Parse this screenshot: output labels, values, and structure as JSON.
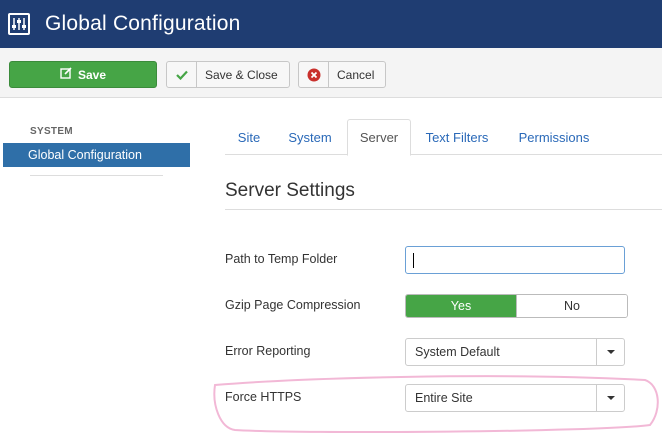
{
  "header": {
    "title": "Global Configuration",
    "icon": "sliders-icon"
  },
  "toolbar": {
    "save_label": "Save",
    "save_close_label": "Save & Close",
    "cancel_label": "Cancel"
  },
  "sidebar": {
    "heading": "SYSTEM",
    "items": [
      {
        "label": "Global Configuration",
        "active": true
      }
    ]
  },
  "tabs": [
    {
      "label": "Site",
      "active": false
    },
    {
      "label": "System",
      "active": false
    },
    {
      "label": "Server",
      "active": true
    },
    {
      "label": "Text Filters",
      "active": false
    },
    {
      "label": "Permissions",
      "active": false
    }
  ],
  "section": {
    "title": "Server Settings",
    "fields": {
      "temp_path": {
        "label": "Path to Temp Folder",
        "value": ""
      },
      "gzip": {
        "label": "Gzip Page Compression",
        "on_label": "Yes",
        "off_label": "No",
        "selected": "Yes"
      },
      "error_reporting": {
        "label": "Error Reporting",
        "value": "System Default"
      },
      "force_https": {
        "label": "Force HTTPS",
        "value": "Entire Site"
      }
    }
  },
  "colors": {
    "header_bg": "#1f3d72",
    "save_green": "#46a546",
    "active_blue": "#2f6fa8",
    "highlight_pink": "#f2b8d6"
  }
}
